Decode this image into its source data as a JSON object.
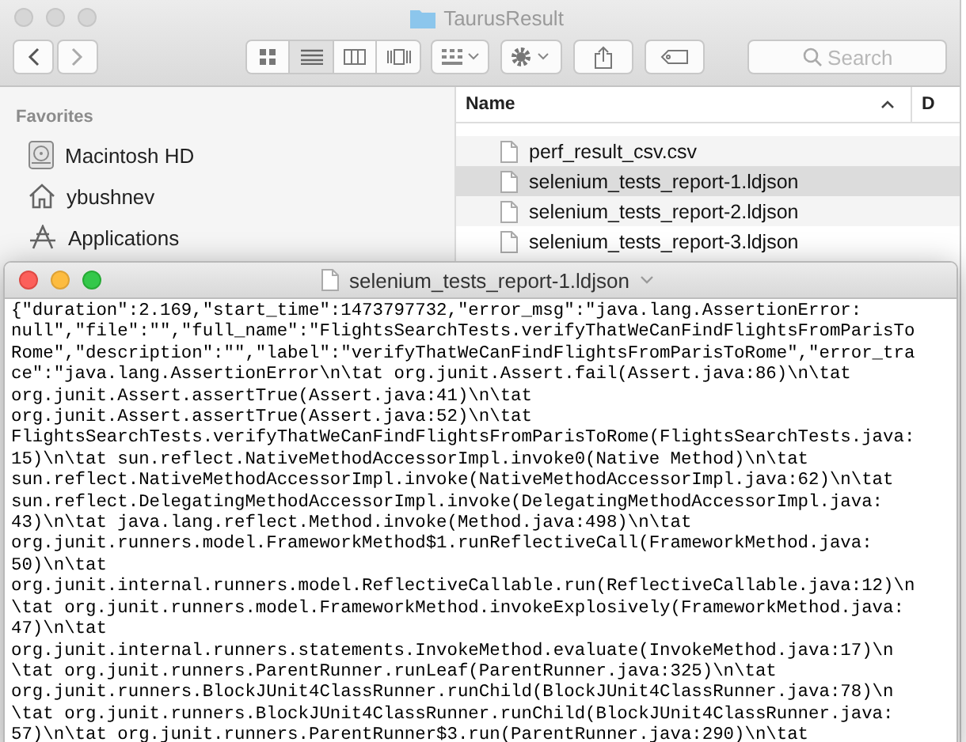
{
  "finder": {
    "title": "TaurusResult",
    "search": {
      "placeholder": "Search"
    },
    "view_modes": [
      {
        "kind": "icons",
        "selected": false
      },
      {
        "kind": "list",
        "selected": true
      },
      {
        "kind": "columns",
        "selected": false
      },
      {
        "kind": "coverflow",
        "selected": false
      }
    ],
    "sidebar": {
      "heading": "Favorites",
      "items": [
        {
          "label": "Macintosh HD",
          "kind": "disk"
        },
        {
          "label": "ybushnev",
          "kind": "home"
        },
        {
          "label": "Applications",
          "kind": "apps"
        }
      ]
    },
    "file_list": {
      "columns": [
        "Name",
        "D"
      ],
      "rows": [
        {
          "name": "perf_result_csv.csv",
          "selected": false
        },
        {
          "name": "selenium_tests_report-1.ldjson",
          "selected": true
        },
        {
          "name": "selenium_tests_report-2.ldjson",
          "selected": false
        },
        {
          "name": "selenium_tests_report-3.ldjson",
          "selected": false
        }
      ]
    }
  },
  "editor": {
    "title": "selenium_tests_report-1.ldjson",
    "lines": [
      "{\"duration\":2.169,\"start_time\":1473797732,\"error_msg\":\"java.lang.AssertionError:",
      "null\",\"file\":\"\",\"full_name\":\"FlightsSearchTests.verifyThatWeCanFindFlightsFromParisTo",
      "Rome\",\"description\":\"\",\"label\":\"verifyThatWeCanFindFlightsFromParisToRome\",\"error_tra",
      "ce\":\"java.lang.AssertionError\\n\\tat org.junit.Assert.fail(Assert.java:86)\\n\\tat",
      "org.junit.Assert.assertTrue(Assert.java:41)\\n\\tat",
      "org.junit.Assert.assertTrue(Assert.java:52)\\n\\tat",
      "FlightsSearchTests.verifyThatWeCanFindFlightsFromParisToRome(FlightsSearchTests.java:",
      "15)\\n\\tat sun.reflect.NativeMethodAccessorImpl.invoke0(Native Method)\\n\\tat",
      "sun.reflect.NativeMethodAccessorImpl.invoke(NativeMethodAccessorImpl.java:62)\\n\\tat",
      "sun.reflect.DelegatingMethodAccessorImpl.invoke(DelegatingMethodAccessorImpl.java:",
      "43)\\n\\tat java.lang.reflect.Method.invoke(Method.java:498)\\n\\tat",
      "org.junit.runners.model.FrameworkMethod$1.runReflectiveCall(FrameworkMethod.java:",
      "50)\\n\\tat",
      "org.junit.internal.runners.model.ReflectiveCallable.run(ReflectiveCallable.java:12)\\n",
      "\\tat org.junit.runners.model.FrameworkMethod.invokeExplosively(FrameworkMethod.java:",
      "47)\\n\\tat",
      "org.junit.internal.runners.statements.InvokeMethod.evaluate(InvokeMethod.java:17)\\n",
      "\\tat org.junit.runners.ParentRunner.runLeaf(ParentRunner.java:325)\\n\\tat",
      "org.junit.runners.BlockJUnit4ClassRunner.runChild(BlockJUnit4ClassRunner.java:78)\\n",
      "\\tat org.junit.runners.BlockJUnit4ClassRunner.runChild(BlockJUnit4ClassRunner.java:",
      "57)\\n\\tat org.junit.runners.ParentRunner$3.run(ParentRunner.java:290)\\n\\tat"
    ]
  }
}
